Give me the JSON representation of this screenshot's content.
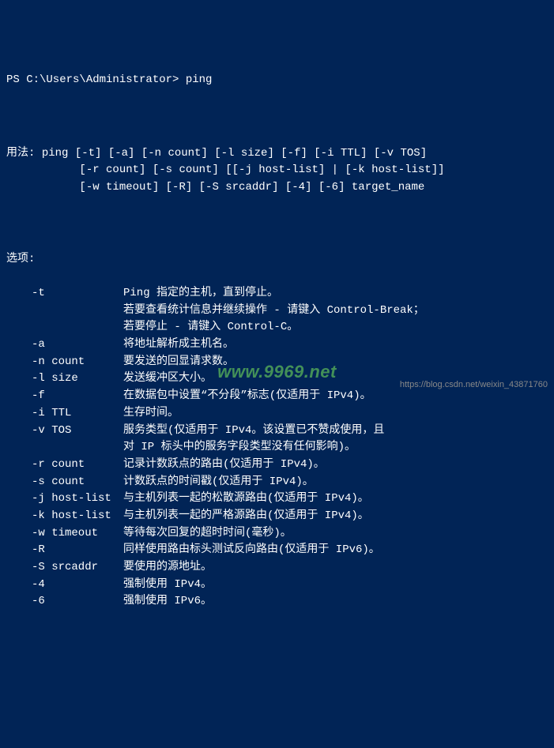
{
  "prompt": {
    "prefix": "PS C:\\Users\\Administrator>",
    "command": "ping"
  },
  "usage": {
    "label": "用法:",
    "lines": [
      "ping [-t] [-a] [-n count] [-l size] [-f] [-i TTL] [-v TOS]",
      "     [-r count] [-s count] [[-j host-list] | [-k host-list]]",
      "     [-w timeout] [-R] [-S srcaddr] [-4] [-6] target_name"
    ]
  },
  "options_label": "选项:",
  "options": [
    {
      "flag": "-t",
      "desc": "Ping 指定的主机，直到停止。"
    },
    {
      "flag": "",
      "desc": "若要查看统计信息并继续操作 - 请键入 Control-Break；"
    },
    {
      "flag": "",
      "desc": "若要停止 - 请键入 Control-C。"
    },
    {
      "flag": "-a",
      "desc": "将地址解析成主机名。"
    },
    {
      "flag": "-n count",
      "desc": "要发送的回显请求数。"
    },
    {
      "flag": "-l size",
      "desc": "发送缓冲区大小。"
    },
    {
      "flag": "-f",
      "desc": "在数据包中设置“不分段”标志(仅适用于 IPv4)。"
    },
    {
      "flag": "-i TTL",
      "desc": "生存时间。"
    },
    {
      "flag": "-v TOS",
      "desc": "服务类型(仅适用于 IPv4。该设置已不赞成使用，且"
    },
    {
      "flag": "",
      "desc": "对 IP 标头中的服务字段类型没有任何影响)。"
    },
    {
      "flag": "-r count",
      "desc": "记录计数跃点的路由(仅适用于 IPv4)。"
    },
    {
      "flag": "-s count",
      "desc": "计数跃点的时间戳(仅适用于 IPv4)。"
    },
    {
      "flag": "-j host-list",
      "desc": "与主机列表一起的松散源路由(仅适用于 IPv4)。"
    },
    {
      "flag": "-k host-list",
      "desc": "与主机列表一起的严格源路由(仅适用于 IPv4)。"
    },
    {
      "flag": "-w timeout",
      "desc": "等待每次回复的超时时间(毫秒)。"
    },
    {
      "flag": "-R",
      "desc": "同样使用路由标头测试反向路由(仅适用于 IPv6)。"
    },
    {
      "flag": "-S srcaddr",
      "desc": "要使用的源地址。"
    },
    {
      "flag": "-4",
      "desc": "强制使用 IPv4。"
    },
    {
      "flag": "-6",
      "desc": "强制使用 IPv6。"
    }
  ],
  "watermark": "www.9969.net",
  "source_url": "https://blog.csdn.net/weixin_43871760"
}
